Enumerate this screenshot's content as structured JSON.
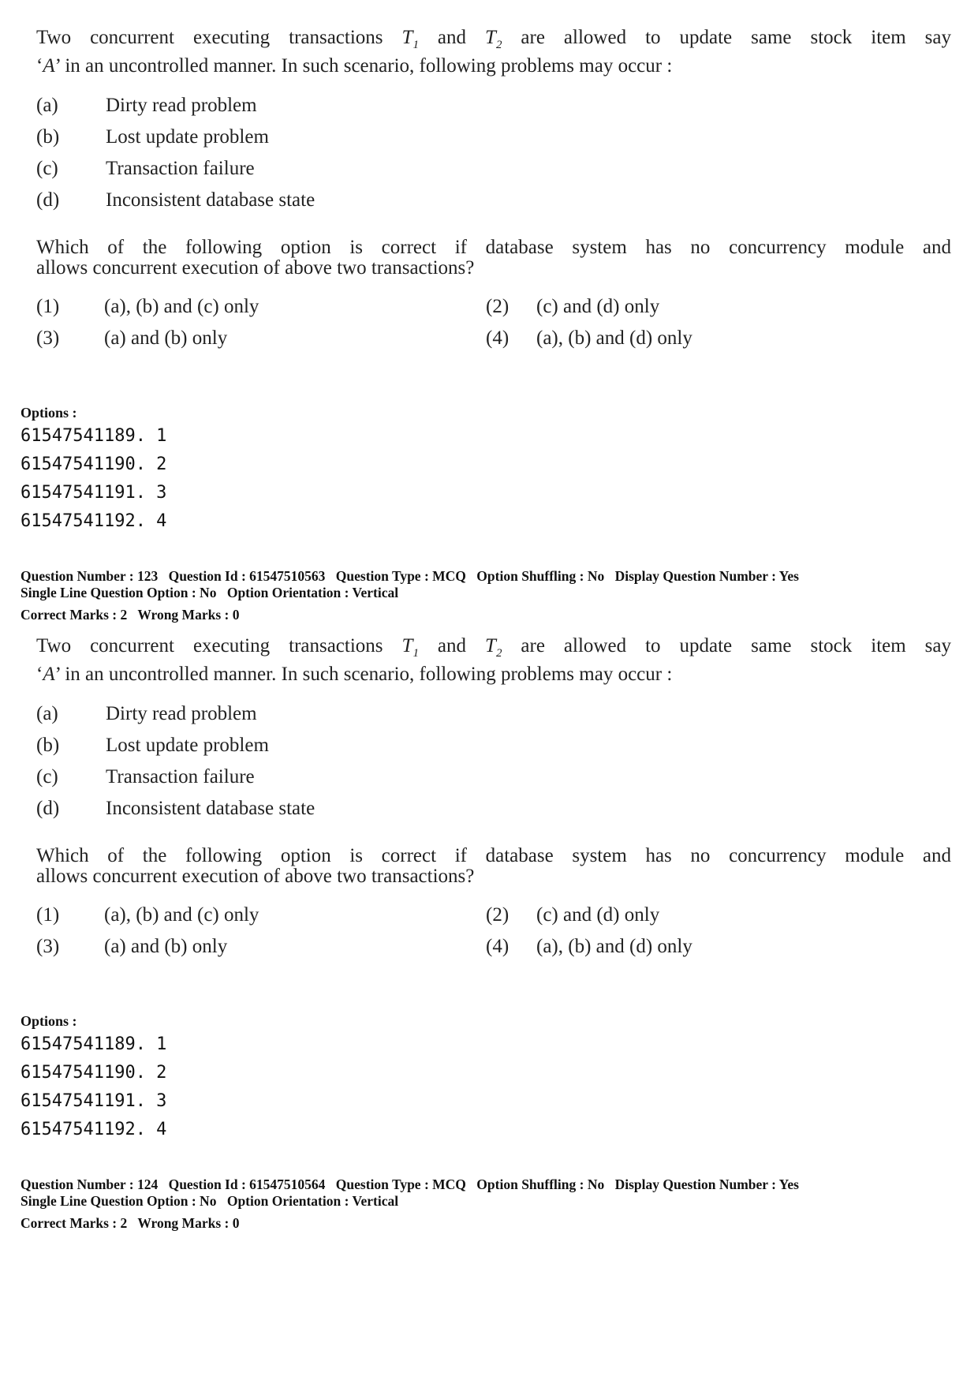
{
  "blocks": [
    {
      "stem": {
        "line1_pre": "Two concurrent executing transactions ",
        "t1": "T",
        "t1_sub": "1",
        "and": " and ",
        "t2": "T",
        "t2_sub": "2",
        "line1_post": " are allowed to update same stock item say",
        "line2_var": "A",
        "line2": " in an uncontrolled manner. In such scenario, following problems may occur :"
      },
      "items": [
        {
          "label": "(a)",
          "text": "Dirty read problem"
        },
        {
          "label": "(b)",
          "text": "Lost update problem"
        },
        {
          "label": "(c)",
          "text": "Transaction failure"
        },
        {
          "label": "(d)",
          "text": "Inconsistent database state"
        }
      ],
      "question": {
        "line1": "Which of the following option is correct if database system has no concurrency module and",
        "line2": "allows concurrent execution of above two transactions?"
      },
      "answers": [
        {
          "num": "(1)",
          "text": "(a), (b) and (c) only"
        },
        {
          "num": "(2)",
          "text": "(c) and (d) only"
        },
        {
          "num": "(3)",
          "text": "(a) and (b) only"
        },
        {
          "num": "(4)",
          "text": "(a), (b) and (d) only"
        }
      ],
      "options_header": "Options :",
      "options": [
        "61547541189. 1",
        "61547541190. 2",
        "61547541191. 3",
        "61547541192. 4"
      ]
    },
    {
      "meta": {
        "question_number": "Question Number : 123",
        "question_id": "Question Id : 61547510563",
        "question_type": "Question Type : MCQ",
        "option_shuffling": "Option Shuffling : No",
        "display_question_number": "Display Question Number : Yes",
        "single_line": "Single Line Question Option : No",
        "orientation": "Option Orientation : Vertical",
        "correct_marks": "Correct Marks : 2",
        "wrong_marks": "Wrong Marks : 0"
      },
      "stem": {
        "line1_pre": "Two concurrent executing transactions ",
        "t1": "T",
        "t1_sub": "1",
        "and": " and ",
        "t2": "T",
        "t2_sub": "2",
        "line1_post": " are allowed to update same stock item say",
        "line2_var": "A",
        "line2": " in an uncontrolled manner. In such scenario, following problems may occur :"
      },
      "items": [
        {
          "label": "(a)",
          "text": "Dirty read problem"
        },
        {
          "label": "(b)",
          "text": "Lost update problem"
        },
        {
          "label": "(c)",
          "text": "Transaction failure"
        },
        {
          "label": "(d)",
          "text": "Inconsistent database state"
        }
      ],
      "question": {
        "line1": "Which of the following option is correct if database system has no concurrency module and",
        "line2": "allows concurrent execution of above two transactions?"
      },
      "answers": [
        {
          "num": "(1)",
          "text": "(a), (b) and (c) only"
        },
        {
          "num": "(2)",
          "text": "(c) and (d) only"
        },
        {
          "num": "(3)",
          "text": "(a) and (b) only"
        },
        {
          "num": "(4)",
          "text": "(a), (b) and (d) only"
        }
      ],
      "options_header": "Options :",
      "options": [
        "61547541189. 1",
        "61547541190. 2",
        "61547541191. 3",
        "61547541192. 4"
      ]
    }
  ],
  "footer_meta": {
    "question_number": "Question Number : 124",
    "question_id": "Question Id : 61547510564",
    "question_type": "Question Type : MCQ",
    "option_shuffling": "Option Shuffling : No",
    "display_question_number": "Display Question Number : Yes",
    "single_line": "Single Line Question Option : No",
    "orientation": "Option Orientation : Vertical",
    "correct_marks": "Correct Marks : 2",
    "wrong_marks": "Wrong Marks : 0"
  }
}
